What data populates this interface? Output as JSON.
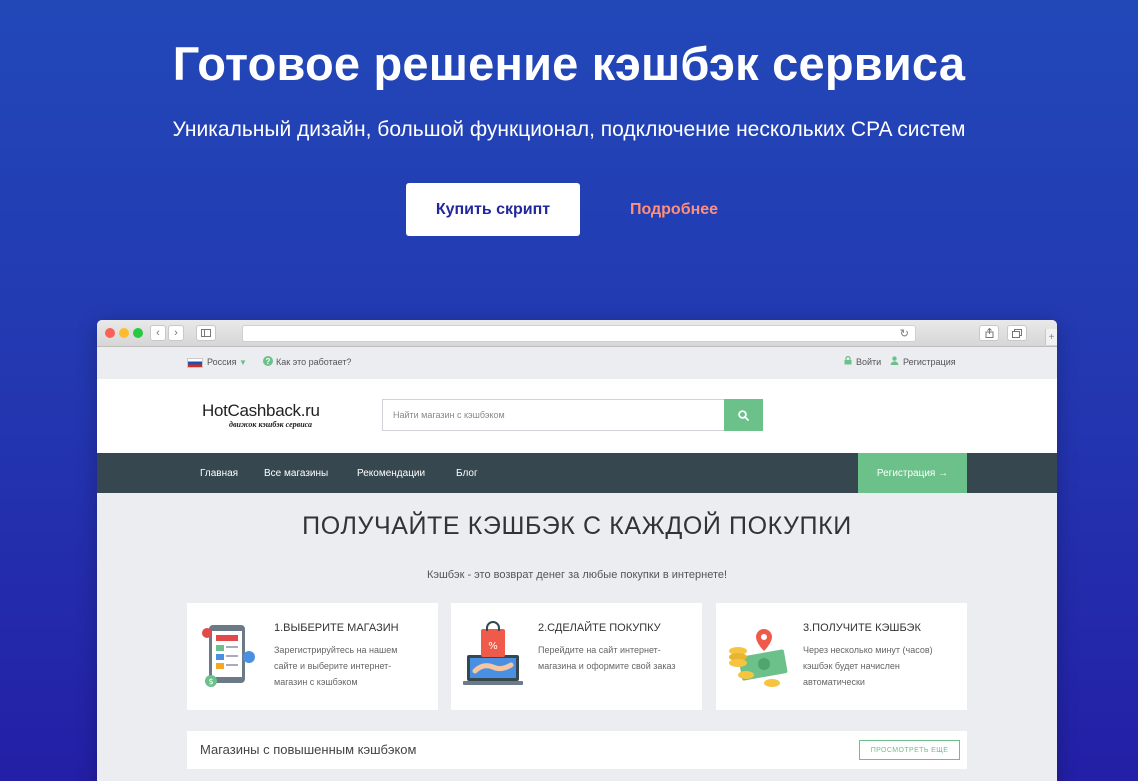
{
  "hero": {
    "title": "Готовое решение кэшбэк сервиса",
    "subtitle": "Уникальный дизайн, большой функционал, подключение нескольких CPA систем",
    "buy_label": "Купить скрипт",
    "more_label": "Подробнее"
  },
  "site": {
    "topbar": {
      "region": "Россия",
      "how_it_works": "Как это работает?",
      "login": "Войти",
      "register": "Регистрация"
    },
    "logo": {
      "name": "HotCashback.ru",
      "tagline": "движок кэшбэк сервиса"
    },
    "search": {
      "placeholder": "Найти магазин с кэшбэком"
    },
    "nav": {
      "items": [
        "Главная",
        "Все магазины",
        "Рекомендации",
        "Блог"
      ],
      "register": "Регистрация →"
    },
    "promo": {
      "title": "ПОЛУЧАЙТЕ КЭШБЭК С КАЖДОЙ ПОКУПКИ",
      "subtitle": "Кэшбэк - это возврат денег за любые покупки в интернете!"
    },
    "steps": [
      {
        "title": "1.ВЫБЕРИТЕ МАГАЗИН",
        "text": "Зарегистрируйтесь на нашем сайте и выберите интернет-магазин с кэшбэком"
      },
      {
        "title": "2.СДЕЛАЙТЕ ПОКУПКУ",
        "text": "Перейдите на сайт интернет-магазина и оформите свой заказ"
      },
      {
        "title": "3.ПОЛУЧИТЕ КЭШБЭК",
        "text": "Через несколько минут (часов) кэшбэк будет начислен автоматически"
      }
    ],
    "shops": {
      "title": "Магазины с повышенным кэшбэком",
      "see_more": "ПРОСМОТРЕТЬ ЕЩЕ"
    }
  },
  "colors": {
    "accent_green": "#6cc08a",
    "nav_dark": "#37474f",
    "hero_blue": "#2248b8",
    "more_link": "#ff8f7a"
  }
}
